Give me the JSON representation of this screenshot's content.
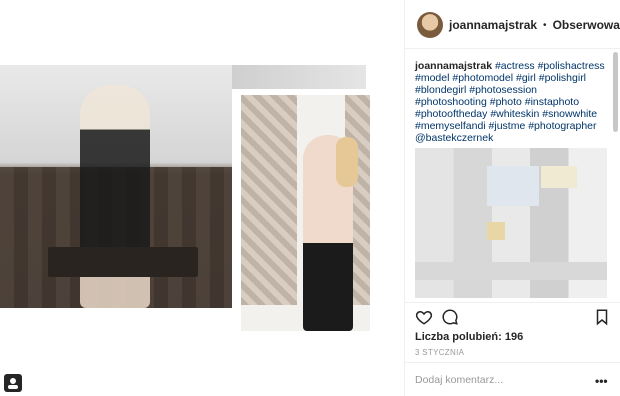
{
  "post": {
    "username": "joannamajstrak",
    "separator": "•",
    "follow_label": "Obserwowanie",
    "caption_user": "joannamajstrak",
    "caption_tags": "#actress #polishactress #model #photomodel #girl #polishgirl #blondegirl #photosession #photoshooting #photo #instaphoto #photooftheday #whiteskin #snowwhite #memyselfandi #justme #photographer @bastekczernek",
    "likes_label": "Liczba polubień: 196",
    "date_label": "3 STYCZNIA",
    "comment_placeholder": "Dodaj komentarz...",
    "more_label": "•••"
  },
  "icons": {
    "heart": "heart-icon",
    "comment": "comment-icon",
    "save": "bookmark-icon",
    "corner": "user-tag-icon"
  }
}
